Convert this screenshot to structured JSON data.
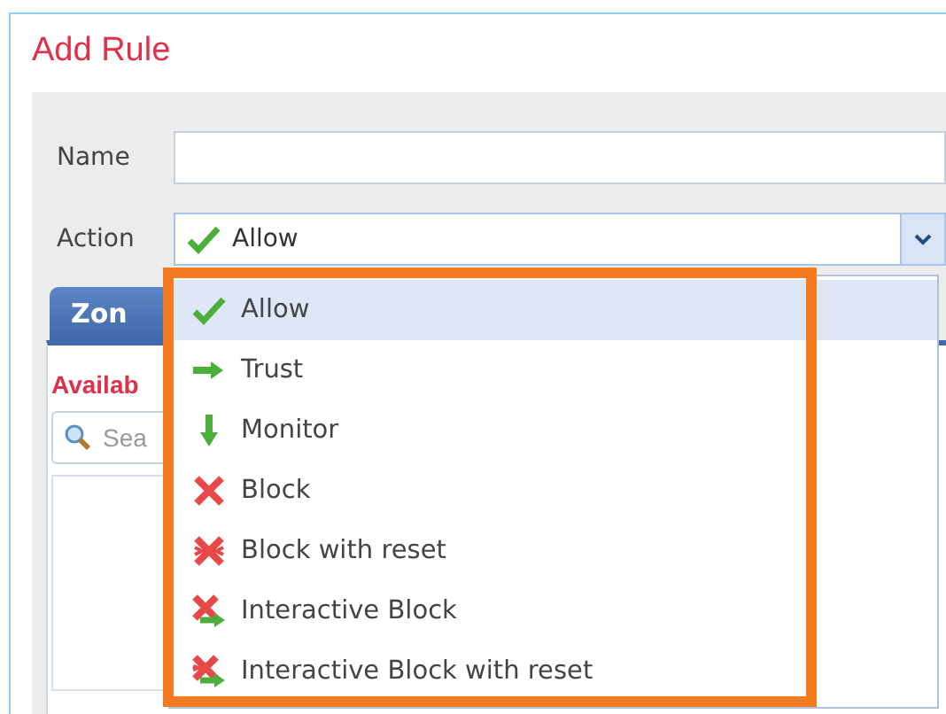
{
  "dialog": {
    "title": "Add Rule"
  },
  "form": {
    "name_label": "Name",
    "action_label": "Action",
    "action_value": "Allow"
  },
  "tab": {
    "label": "Zon",
    "selected": true
  },
  "available": {
    "label": "Availab",
    "search_placeholder": "Sea"
  },
  "dropdown": {
    "items": [
      {
        "label": "Allow",
        "kind": "allow",
        "selected": true
      },
      {
        "label": "Trust",
        "kind": "trust",
        "selected": false
      },
      {
        "label": "Monitor",
        "kind": "monitor",
        "selected": false
      },
      {
        "label": "Block",
        "kind": "block",
        "selected": false
      },
      {
        "label": "Block with reset",
        "kind": "block-reset",
        "selected": false
      },
      {
        "label": "Interactive Block",
        "kind": "interactive-block",
        "selected": false
      },
      {
        "label": "Interactive Block with reset",
        "kind": "interactive-block-reset",
        "selected": false
      }
    ]
  }
}
